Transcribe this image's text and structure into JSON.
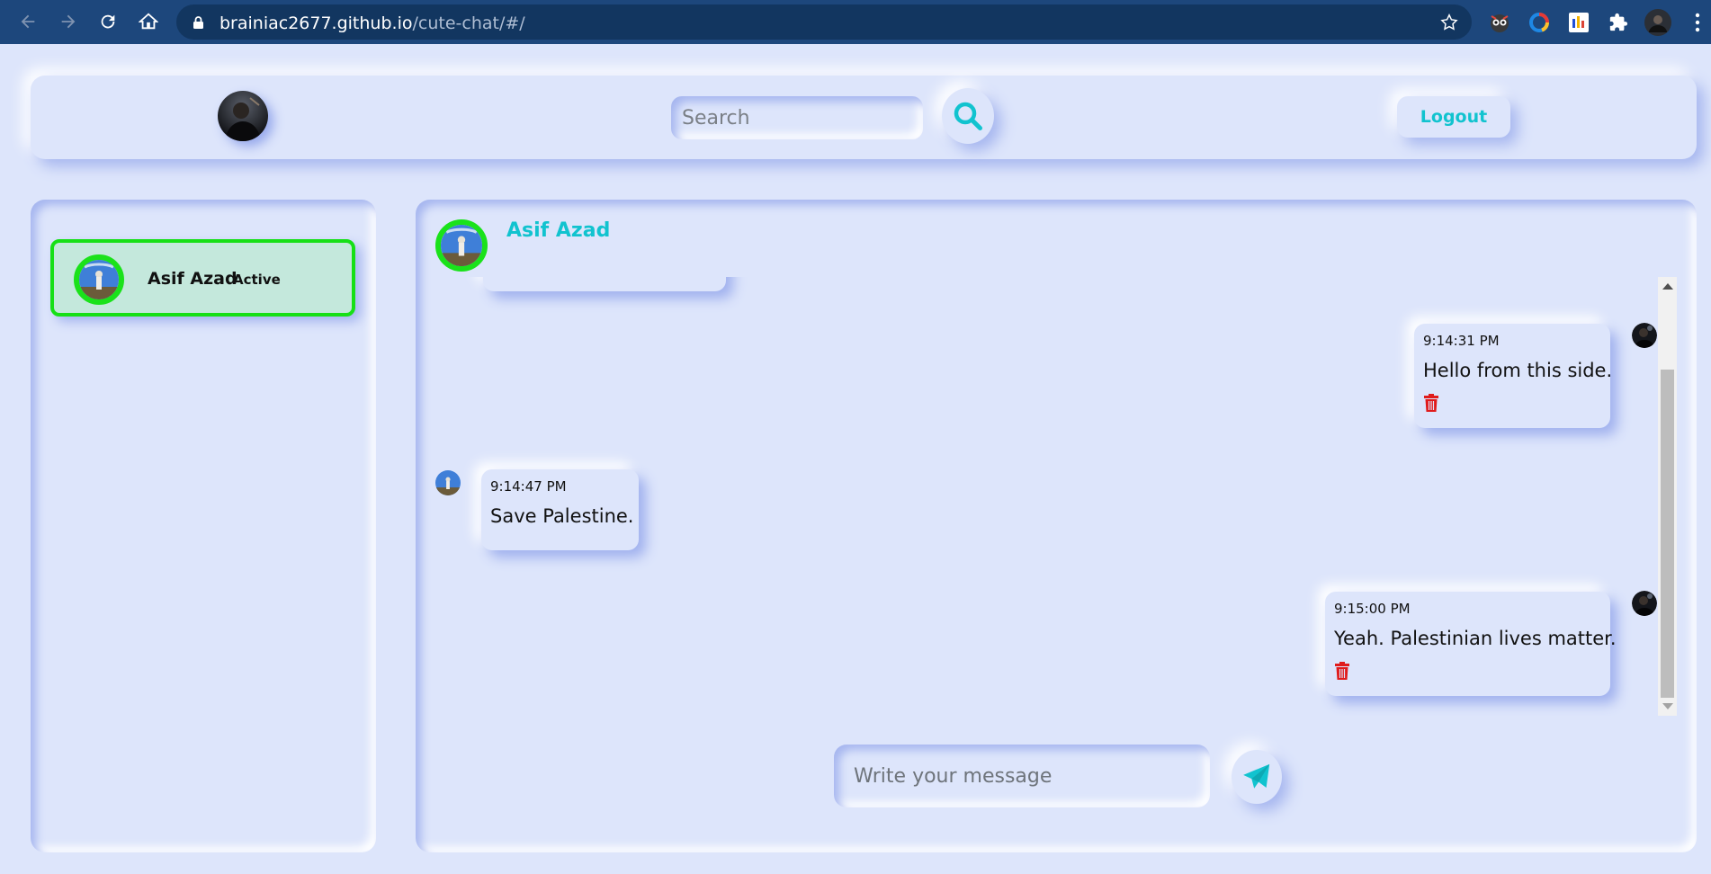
{
  "browser": {
    "url_host": "brainiac2677.github.io",
    "url_path": "/cute-chat/#/"
  },
  "header": {
    "search_placeholder": "Search",
    "logout_label": "Logout"
  },
  "sidebar": {
    "contacts": [
      {
        "name": "Asif Azad",
        "status": "Active"
      }
    ]
  },
  "chat": {
    "partner_name": "Asif Azad",
    "messages": [
      {
        "side": "right",
        "time": "9:14:31 PM",
        "text": "Hello from this side.",
        "deletable": true
      },
      {
        "side": "left",
        "time": "9:14:47 PM",
        "text": "Save Palestine.",
        "deletable": false
      },
      {
        "side": "right",
        "time": "9:15:00 PM",
        "text": "Yeah. Palestinian lives matter.",
        "deletable": true
      }
    ],
    "input_placeholder": "Write your message"
  },
  "colors": {
    "accent": "#11c3cf",
    "active_ring": "#1ae21a",
    "delete": "#e01b1b",
    "background": "#dde5fb"
  }
}
